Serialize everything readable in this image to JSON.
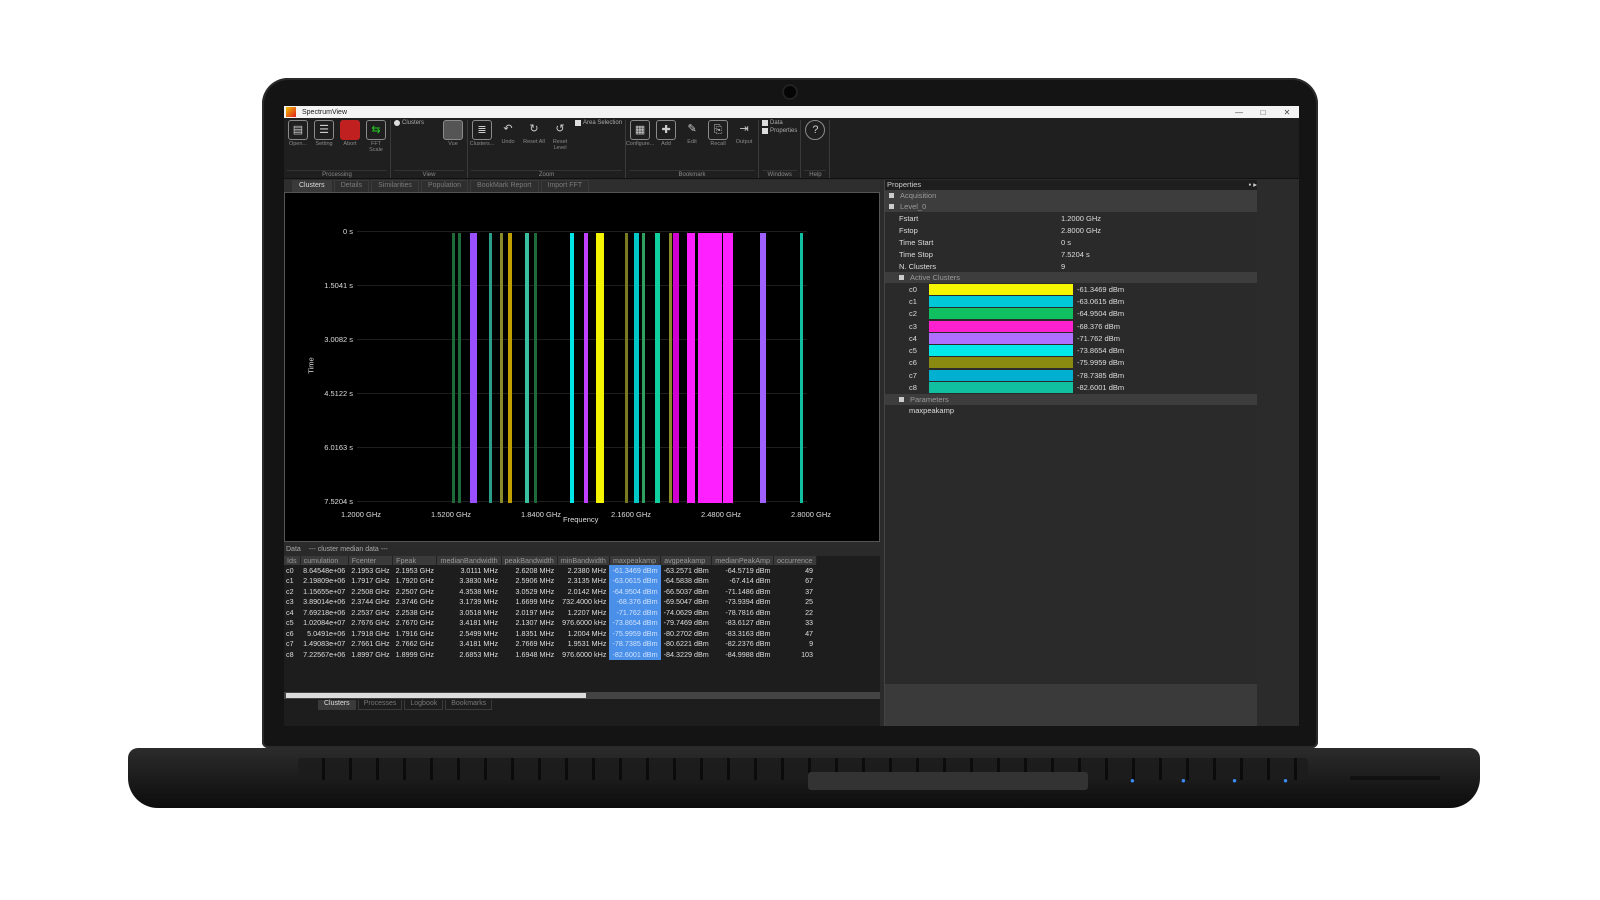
{
  "window": {
    "title": "SpectrumView",
    "controls": [
      "—",
      "□",
      "✕"
    ]
  },
  "ribbon": {
    "groups": [
      {
        "label": "Processing",
        "buttons": [
          {
            "label": "Open...",
            "icon": "open-icon"
          },
          {
            "label": "Setting",
            "icon": "settings-list-icon"
          },
          {
            "label": "Abort",
            "icon": "abort-icon"
          },
          {
            "label": "FFT Scale",
            "icon": "fft-scale-icon"
          }
        ]
      },
      {
        "label": "View",
        "checks": [
          "Clusters"
        ],
        "buttons": [
          {
            "label": "Vue",
            "icon": "vue-icon"
          }
        ]
      },
      {
        "label": "Zoom",
        "buttons": [
          {
            "label": "Clusters...",
            "icon": "clusters-icon"
          },
          {
            "label": "Undo",
            "icon": "undo-icon"
          },
          {
            "label": "Reset All",
            "icon": "reset-all-icon"
          },
          {
            "label": "Reset Level",
            "icon": "reset-level-icon"
          }
        ],
        "checks": [
          "Area Selection"
        ]
      },
      {
        "label": "Bookmark",
        "buttons": [
          {
            "label": "Configure...",
            "icon": "configure-icon"
          },
          {
            "label": "Add",
            "icon": "add-icon"
          },
          {
            "label": "Edit",
            "icon": "edit-icon"
          },
          {
            "label": "Recall",
            "icon": "recall-icon"
          },
          {
            "label": "Output",
            "icon": "output-icon"
          }
        ]
      },
      {
        "label": "Windows",
        "checks": [
          "Data",
          "Properties"
        ]
      },
      {
        "label": "Help",
        "buttons": [
          {
            "label": "?",
            "icon": "help-icon"
          }
        ]
      }
    ]
  },
  "tabs": [
    "Clusters",
    "Details",
    "Similarities",
    "Population",
    "BookMark Report",
    "Import FFT"
  ],
  "chart_data": {
    "type": "scatter",
    "xlabel": "Frequency",
    "ylabel": "Time",
    "x_ticks": [
      "1.2000 GHz",
      "1.5200 GHz",
      "1.8400 GHz",
      "2.1600 GHz",
      "2.4800 GHz",
      "2.8000 GHz"
    ],
    "y_ticks": [
      "0 s",
      "1.5041 s",
      "3.0082 s",
      "4.5122 s",
      "6.0163 s",
      "7.5204 s"
    ],
    "xlim": [
      1.2,
      2.8
    ],
    "ylim": [
      0,
      7.5204
    ],
    "grid": true,
    "bands": [
      {
        "freq_ghz": 1.528,
        "width_mhz": 2,
        "color": "#1e6b3a"
      },
      {
        "freq_ghz": 1.551,
        "width_mhz": 2,
        "color": "#1e6b3a"
      },
      {
        "freq_ghz": 1.6,
        "width_mhz": 4,
        "color": "#9a50ff"
      },
      {
        "freq_ghz": 1.66,
        "width_mhz": 2,
        "color": "#2a9e8a"
      },
      {
        "freq_ghz": 1.7,
        "width_mhz": 2,
        "color": "#8a8a2a"
      },
      {
        "freq_ghz": 1.73,
        "width_mhz": 2,
        "color": "#c0a000"
      },
      {
        "freq_ghz": 1.79,
        "width_mhz": 2,
        "color": "#3ac0a0"
      },
      {
        "freq_ghz": 1.82,
        "width_mhz": 2,
        "color": "#1e6b3a"
      },
      {
        "freq_ghz": 1.95,
        "width_mhz": 3,
        "color": "#00e5e5"
      },
      {
        "freq_ghz": 2.0,
        "width_mhz": 2,
        "color": "#c040ff"
      },
      {
        "freq_ghz": 2.05,
        "width_mhz": 5,
        "color": "#f5f500"
      },
      {
        "freq_ghz": 2.145,
        "width_mhz": 2,
        "color": "#7a7a20"
      },
      {
        "freq_ghz": 2.18,
        "width_mhz": 3,
        "color": "#00c8c8"
      },
      {
        "freq_ghz": 2.205,
        "width_mhz": 2,
        "color": "#2ea060"
      },
      {
        "freq_ghz": 2.254,
        "width_mhz": 3,
        "color": "#10d0a0"
      },
      {
        "freq_ghz": 2.3,
        "width_mhz": 2,
        "color": "#8a8a2a"
      },
      {
        "freq_ghz": 2.32,
        "width_mhz": 4,
        "color": "#d000d0"
      },
      {
        "freq_ghz": 2.375,
        "width_mhz": 5,
        "color": "#ff20ff"
      },
      {
        "freq_ghz": 2.42,
        "width_mhz": 8,
        "color": "#ff20ff"
      },
      {
        "freq_ghz": 2.46,
        "width_mhz": 8,
        "color": "#ff20ff"
      },
      {
        "freq_ghz": 2.505,
        "width_mhz": 6,
        "color": "#ff20ff"
      },
      {
        "freq_ghz": 2.63,
        "width_mhz": 4,
        "color": "#a060ff"
      },
      {
        "freq_ghz": 2.765,
        "width_mhz": 2,
        "color": "#10c0a0"
      }
    ]
  },
  "data_panel": {
    "header": "Data",
    "subtitle": "--- cluster median data ---",
    "columns": [
      "Ids",
      "cumulation",
      "Fcenter",
      "Fpeak",
      "medianBandwidth",
      "peakBandwidth",
      "minBandwidth",
      "maxpeakamp",
      "avgpeakamp",
      "medianPeakAmp",
      "occurrence"
    ],
    "rows": [
      [
        "c0",
        "8.64548e+06",
        "2.1953 GHz",
        "2.1953 GHz",
        "3.0111 MHz",
        "2.6208 MHz",
        "2.2380 MHz",
        "-61.3469 dBm",
        "-63.2571 dBm",
        "-64.5719 dBm",
        "49"
      ],
      [
        "c1",
        "2.19809e+06",
        "1.7917 GHz",
        "1.7920 GHz",
        "3.3830 MHz",
        "2.5906 MHz",
        "2.3135 MHz",
        "-63.0615 dBm",
        "-64.5838 dBm",
        "-67.414 dBm",
        "67"
      ],
      [
        "c2",
        "1.15655e+07",
        "2.2508 GHz",
        "2.2507 GHz",
        "4.3538 MHz",
        "3.0529 MHz",
        "2.0142 MHz",
        "-64.9504 dBm",
        "-66.5037 dBm",
        "-71.1486 dBm",
        "37"
      ],
      [
        "c3",
        "3.89014e+06",
        "2.3744 GHz",
        "2.3746 GHz",
        "3.1739 MHz",
        "1.6699 MHz",
        "732.4000 kHz",
        "-68.376 dBm",
        "-69.5047 dBm",
        "-73.9394 dBm",
        "25"
      ],
      [
        "c4",
        "7.69218e+06",
        "2.2537 GHz",
        "2.2538 GHz",
        "3.0518 MHz",
        "2.0197 MHz",
        "1.2207 MHz",
        "-71.762 dBm",
        "-74.0629 dBm",
        "-78.7816 dBm",
        "22"
      ],
      [
        "c5",
        "1.02084e+07",
        "2.7676 GHz",
        "2.7670 GHz",
        "3.4181 MHz",
        "2.1307 MHz",
        "976.6000 kHz",
        "-73.8654 dBm",
        "-79.7469 dBm",
        "-83.6127 dBm",
        "33"
      ],
      [
        "c6",
        "5.0491e+06",
        "1.7918 GHz",
        "1.7916 GHz",
        "2.5499 MHz",
        "1.8351 MHz",
        "1.2004 MHz",
        "-75.9959 dBm",
        "-80.2702 dBm",
        "-83.3163 dBm",
        "47"
      ],
      [
        "c7",
        "1.49083e+07",
        "2.7661 GHz",
        "2.7662 GHz",
        "3.4181 MHz",
        "2.7669 MHz",
        "1.9531 MHz",
        "-78.7385 dBm",
        "-80.6221 dBm",
        "-82.2376 dBm",
        "9"
      ],
      [
        "c8",
        "7.22567e+06",
        "1.8997 GHz",
        "1.8999 GHz",
        "2.6853 MHz",
        "1.6948 MHz",
        "976.6000 kHz",
        "-82.6001 dBm",
        "-84.3229 dBm",
        "-84.9988 dBm",
        "103"
      ]
    ],
    "bottom_tabs": [
      "Clusters",
      "Processes",
      "Logbook",
      "Bookmarks"
    ]
  },
  "properties": {
    "title": "Properties",
    "sections": {
      "acquisition": "Acquisition",
      "level": "Level_0",
      "active": "Active Clusters",
      "params": "Parameters"
    },
    "fields": [
      {
        "key": "Fstart",
        "value": "1.2000 GHz"
      },
      {
        "key": "Fstop",
        "value": "2.8000 GHz"
      },
      {
        "key": "Time Start",
        "value": "0 s"
      },
      {
        "key": "Time Stop",
        "value": "7.5204 s"
      },
      {
        "key": "N. Clusters",
        "value": "9"
      }
    ],
    "clusters": [
      {
        "name": "c0",
        "color": "#f5f500",
        "value": "-61.3469 dBm"
      },
      {
        "name": "c1",
        "color": "#00c8d8",
        "value": "-63.0615 dBm"
      },
      {
        "name": "c2",
        "color": "#10c060",
        "value": "-64.9504 dBm"
      },
      {
        "name": "c3",
        "color": "#ff20d0",
        "value": "-68.376 dBm"
      },
      {
        "name": "c4",
        "color": "#b070ff",
        "value": "-71.762 dBm"
      },
      {
        "name": "c5",
        "color": "#00e8e8",
        "value": "-73.8654 dBm"
      },
      {
        "name": "c6",
        "color": "#8a8a10",
        "value": "-75.9959 dBm"
      },
      {
        "name": "c7",
        "color": "#00b0d0",
        "value": "-78.7385 dBm"
      },
      {
        "name": "c8",
        "color": "#10c0a0",
        "value": "-82.6001 dBm"
      }
    ],
    "parameter": "maxpeakamp"
  }
}
